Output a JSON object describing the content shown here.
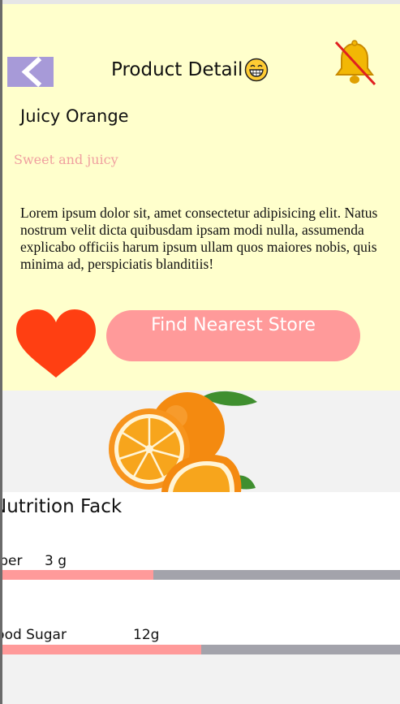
{
  "header": {
    "title": "Product Detail",
    "back_icon": "chevron-left-icon",
    "emoji_icon": "grinning-face-emoji",
    "notification_icon": "bell-muted-icon"
  },
  "product": {
    "name": "Juicy Orange",
    "tagline": "Sweet and juicy",
    "description": "Lorem ipsum dolor sit, amet consectetur adipisicing elit. Natus nostrum velit dicta quibusdam ipsam modi nulla, assumenda explicabo officiis harum ipsum ullam quos maiores nobis, quis minima ad, perspiciatis blanditiis!",
    "favorite_icon": "heart-icon",
    "image": "orange-fruit-image"
  },
  "actions": {
    "find_store_label": "Find Nearest Store"
  },
  "nutrition": {
    "title": "Nutrition Fack",
    "rows": [
      {
        "label": "Fiber",
        "value": "3 g",
        "progress": 0.38
      },
      {
        "label": "Food Sugar",
        "value": "12g",
        "progress": 0.5
      }
    ]
  },
  "colors": {
    "card_bg": "#ffffcc",
    "accent": "#ff9a9a",
    "back_button": "#a79ad8",
    "heart": "#ff3f12",
    "bar_track": "#a3a3ab",
    "tagline": "#f0a0a0"
  }
}
